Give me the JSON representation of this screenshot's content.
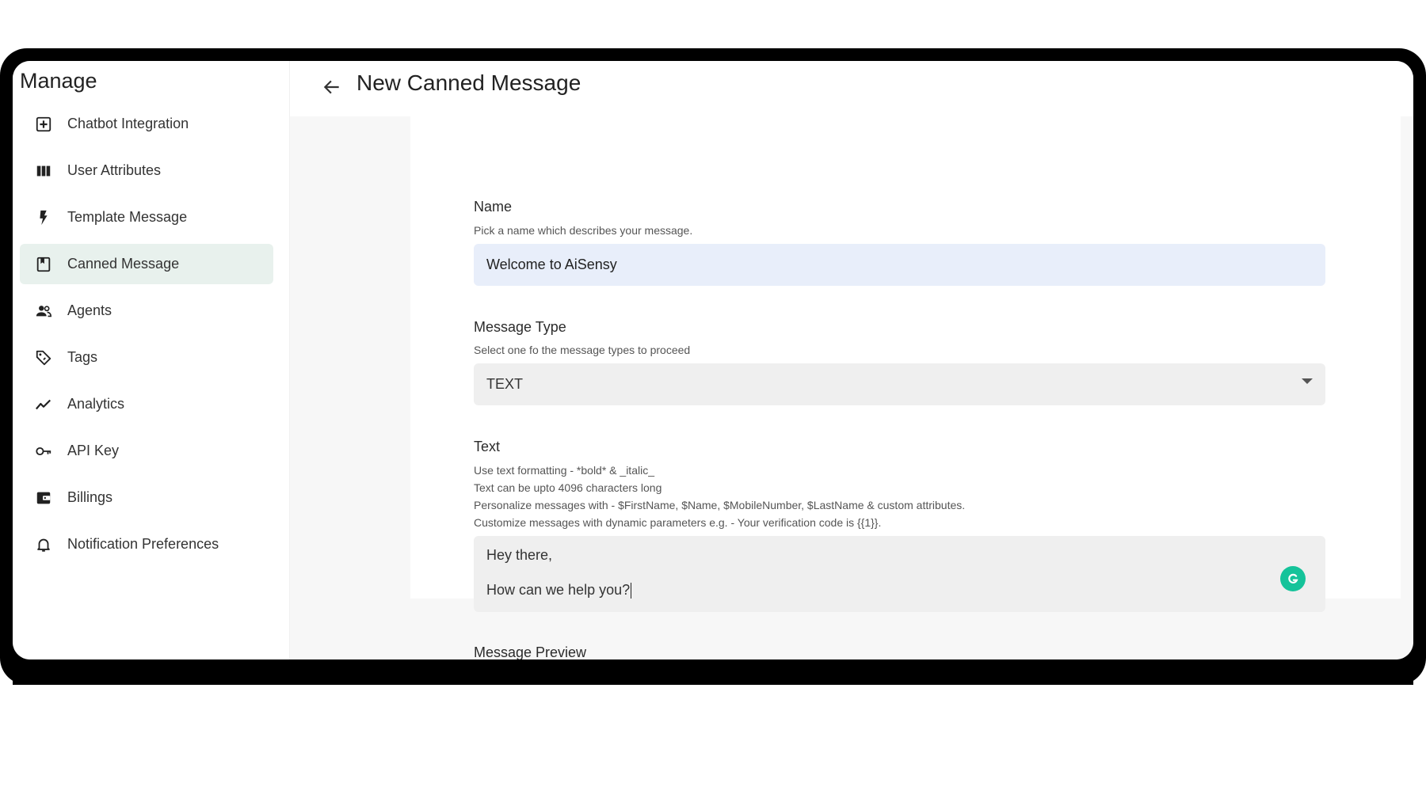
{
  "sidebar": {
    "title": "Manage",
    "items": [
      {
        "label": "Chatbot Integration",
        "icon": "add-box-icon",
        "active": false
      },
      {
        "label": "User Attributes",
        "icon": "columns-icon",
        "active": false
      },
      {
        "label": "Template Message",
        "icon": "lightning-bolt-icon",
        "active": false
      },
      {
        "label": "Canned Message",
        "icon": "bookmark-page-icon",
        "active": true
      },
      {
        "label": "Agents",
        "icon": "people-icon",
        "active": false
      },
      {
        "label": "Tags",
        "icon": "tag-icon",
        "active": false
      },
      {
        "label": "Analytics",
        "icon": "trend-line-icon",
        "active": false
      },
      {
        "label": "API Key",
        "icon": "key-icon",
        "active": false
      },
      {
        "label": "Billings",
        "icon": "wallet-icon",
        "active": false
      },
      {
        "label": "Notification Preferences",
        "icon": "bell-icon",
        "active": false
      }
    ]
  },
  "header": {
    "back_icon": "arrow-left-icon",
    "title": "New Canned Message"
  },
  "form": {
    "name": {
      "label": "Name",
      "hint": "Pick a name which describes your message.",
      "value": "Welcome to AiSensy"
    },
    "message_type": {
      "label": "Message Type",
      "hint": "Select one fo the message types to proceed",
      "value": "TEXT"
    },
    "text": {
      "label": "Text",
      "hints": [
        "Use text formatting - *bold* & _italic_",
        "Text can be upto 4096 characters long",
        "Personalize messages with - $FirstName, $Name, $MobileNumber, $LastName & custom attributes.",
        "Customize messages with dynamic parameters e.g. - Your verification code is {{1}}."
      ],
      "line1": "Hey there,",
      "line2": "How can we help you?"
    },
    "preview_label": "Message Preview"
  },
  "colors": {
    "active_nav_bg": "#e8f1ed",
    "name_input_bg": "#e8eefa",
    "field_bg": "#efefef",
    "grammarly": "#15c39a"
  }
}
